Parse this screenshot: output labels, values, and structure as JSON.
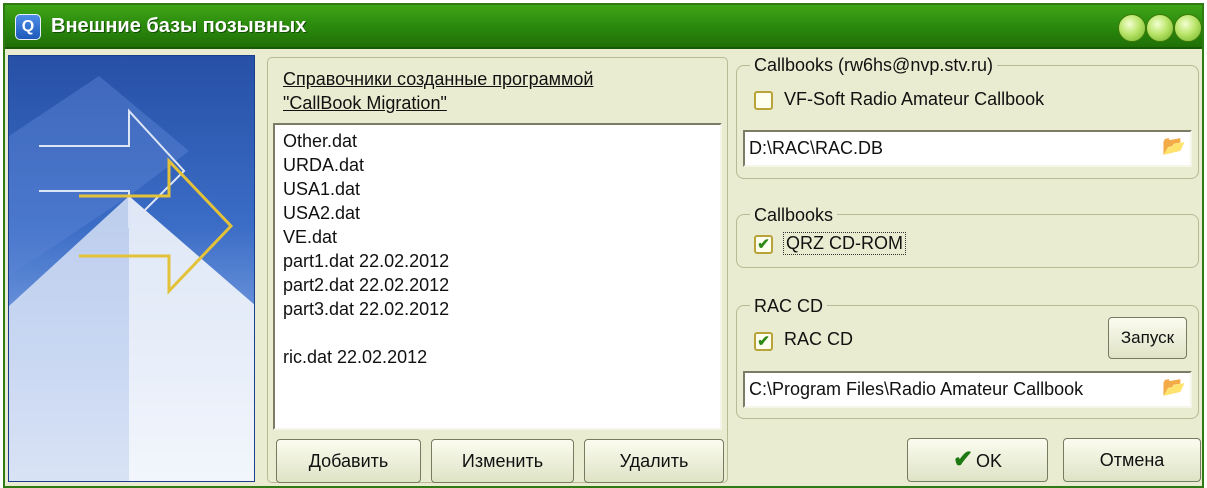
{
  "window": {
    "title": "Внешние базы позывных",
    "icon": "app-logo-icon",
    "icon_glyph": "Q",
    "title_buttons": [
      "minimize-button",
      "maximize-button",
      "close-button"
    ],
    "title_color": "#2d8c0e"
  },
  "left_panel": {
    "title_line1": "Справочники созданные программой",
    "title_line2": "\"CallBook Migration\"",
    "items": [
      "Other.dat",
      "URDA.dat",
      "USA1.dat",
      "USA2.dat",
      "VE.dat",
      "part1.dat 22.02.2012",
      "part2.dat 22.02.2012",
      "part3.dat 22.02.2012",
      "",
      "ric.dat 22.02.2012"
    ],
    "add_label": "Добавить",
    "edit_label": "Изменить",
    "delete_label": "Удалить"
  },
  "callbooks_group": {
    "legend": "Callbooks (rw6hs@nvp.stv.ru)",
    "checkbox_label": "VF-Soft Radio Amateur Callbook",
    "checked": false,
    "path": "D:\\RAC\\RAC.DB"
  },
  "qrz_group": {
    "legend": "Callbooks",
    "checkbox_label": "QRZ CD-ROM",
    "checked": true
  },
  "rac_group": {
    "legend": "RAC CD",
    "checkbox_label": "RAC CD",
    "checked": true,
    "launch_label": "Запуск",
    "path": "C:\\Program Files\\Radio Amateur Callbook"
  },
  "footer": {
    "ok_label": "OK",
    "cancel_label": "Отмена"
  },
  "icons": {
    "check_glyph": "✔",
    "folder_glyph": "📂"
  }
}
